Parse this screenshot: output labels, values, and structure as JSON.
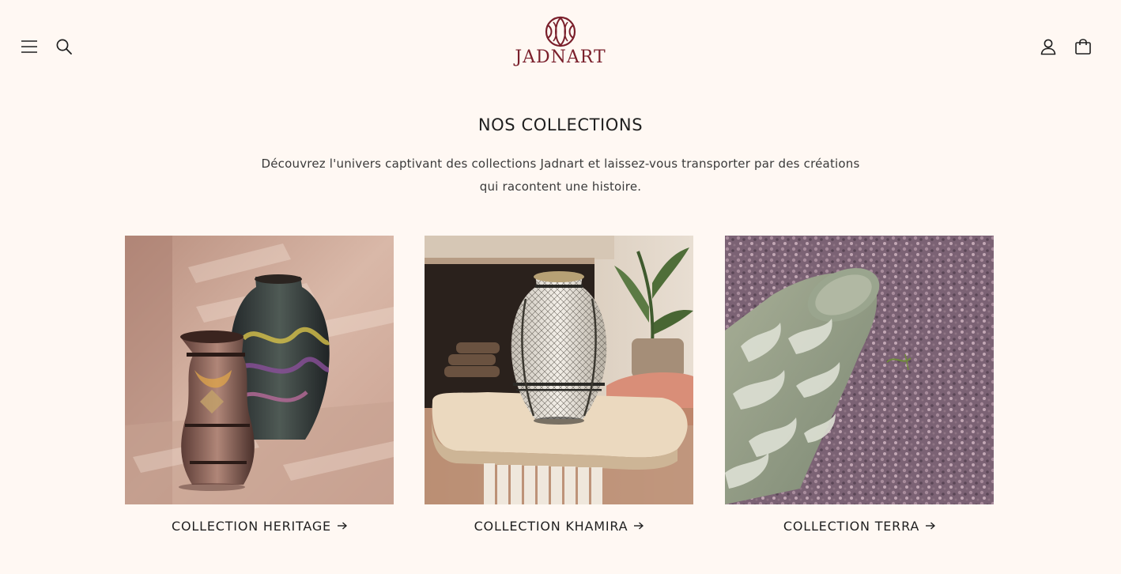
{
  "header": {
    "logo_text": "JADNART",
    "icons": {
      "menu": "hamburger-menu-icon",
      "search": "search-icon",
      "account": "user-icon",
      "cart": "shopping-bag-icon"
    },
    "brand_color": "#7a1f2b"
  },
  "intro": {
    "title": "NOS COLLECTIONS",
    "description": "Découvrez l'univers captivant des collections Jadnart et laissez-vous transporter par des créations qui racontent une histoire."
  },
  "collections": [
    {
      "label": "COLLECTION HERITAGE",
      "image": "two-painted-ceramic-vases"
    },
    {
      "label": "COLLECTION KHAMIRA",
      "image": "patterned-vase-on-side-table"
    },
    {
      "label": "COLLECTION TERRA",
      "image": "green-vase-on-gravel"
    }
  ],
  "colors": {
    "background": "#fff8f3",
    "text": "#1f1f1f"
  }
}
